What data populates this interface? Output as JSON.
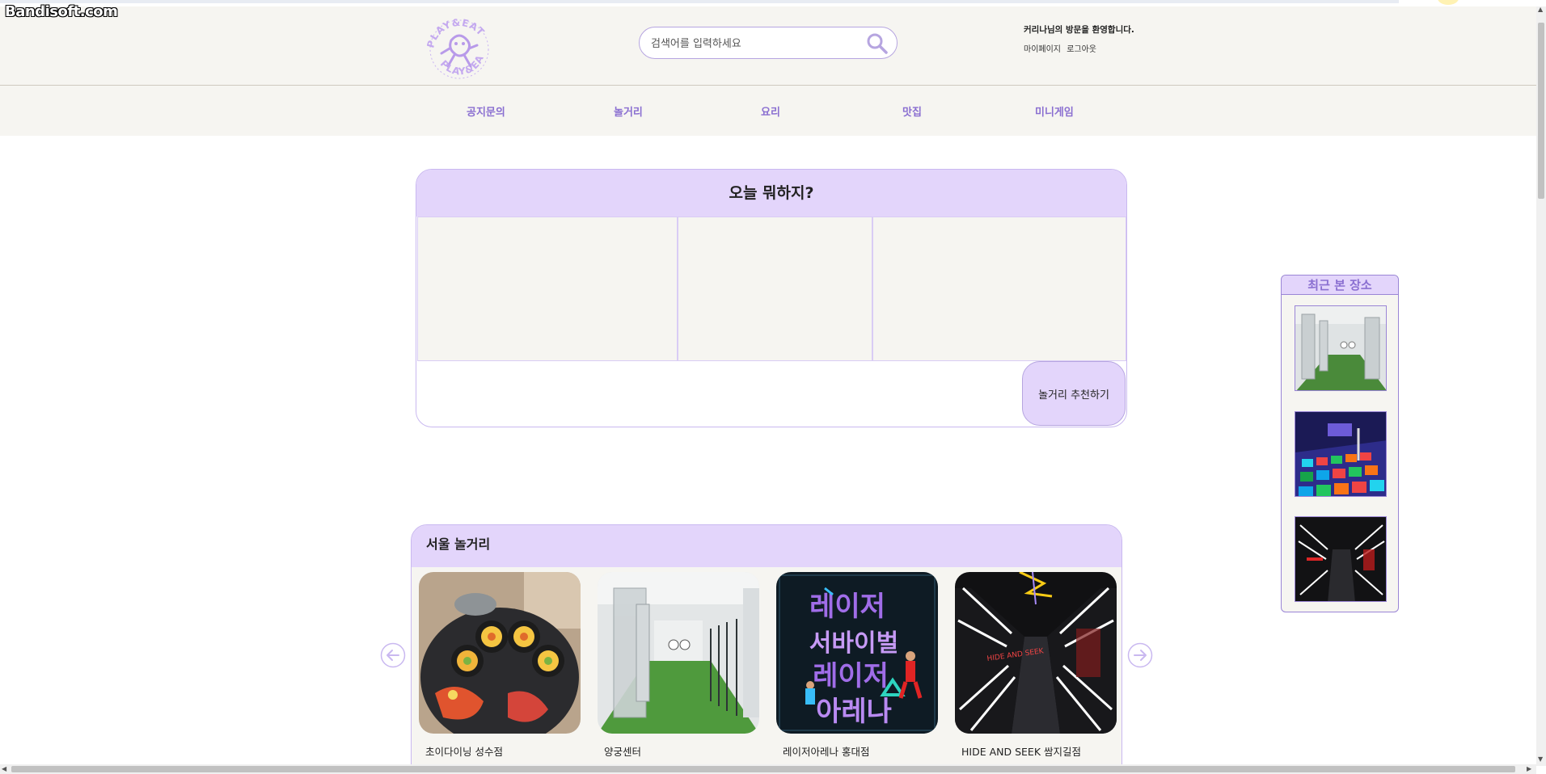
{
  "watermark": "Bandisoft.com",
  "header": {
    "logo_text": "PLAY&EAT",
    "search": {
      "placeholder": "검색어를 입력하세요"
    },
    "welcome": "커리나님의 방문을 환영합니다.",
    "links": {
      "mypage": "마이페이지",
      "logout": "로그아웃"
    }
  },
  "nav": {
    "items": [
      {
        "label": "공지문의"
      },
      {
        "label": "놀거리"
      },
      {
        "label": "요리"
      },
      {
        "label": "맛집"
      },
      {
        "label": "미니게임"
      }
    ]
  },
  "today": {
    "title": "오늘 뭐하지?",
    "recommend_button": "놀거리 추천하기"
  },
  "recent": {
    "title": "최근 본 장소"
  },
  "seoul": {
    "title": "서울 놀거리",
    "cards": [
      {
        "name": "초이다이닝 성수점"
      },
      {
        "name": "양궁센터"
      },
      {
        "name": "레이저아레나 홍대점"
      },
      {
        "name": "HIDE AND SEEK 쌈지길점"
      }
    ],
    "poster_text": [
      "레이저",
      "서바이벌",
      "레이저",
      "아레나"
    ],
    "neon_text": "HIDE AND SEEK"
  },
  "colors": {
    "accent": "#8a6fd1",
    "panel_bg": "#e3d5fb",
    "page_bg": "#f6f5f1"
  }
}
